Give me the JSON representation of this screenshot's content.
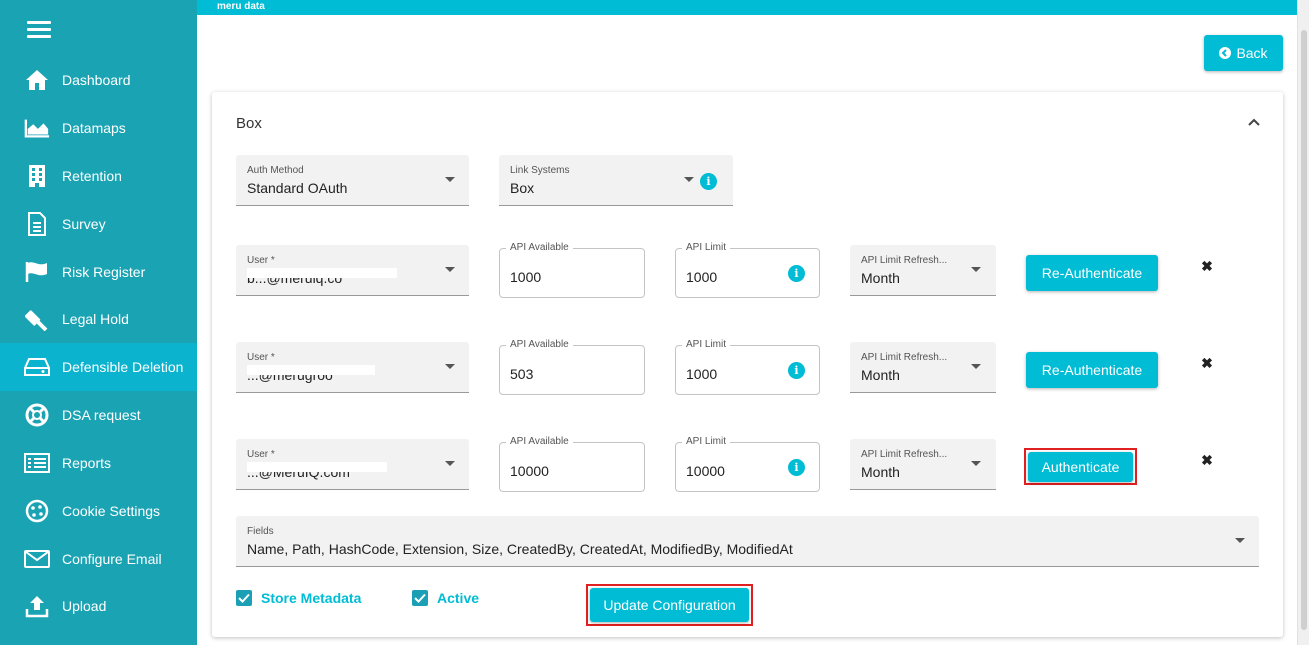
{
  "topbar": {
    "brand": "meru data"
  },
  "sidebar": {
    "items": [
      {
        "label": "Dashboard",
        "icon": "home-icon"
      },
      {
        "label": "Datamaps",
        "icon": "area-chart-icon"
      },
      {
        "label": "Retention",
        "icon": "building-icon"
      },
      {
        "label": "Survey",
        "icon": "document-icon"
      },
      {
        "label": "Risk Register",
        "icon": "flag-icon"
      },
      {
        "label": "Legal Hold",
        "icon": "gavel-icon"
      },
      {
        "label": "Defensible Deletion",
        "icon": "hard-drive-icon",
        "active": true
      },
      {
        "label": "DSA request",
        "icon": "life-ring-icon"
      },
      {
        "label": "Reports",
        "icon": "list-icon"
      },
      {
        "label": "Cookie Settings",
        "icon": "cookie-icon"
      },
      {
        "label": "Configure Email",
        "icon": "envelope-icon"
      },
      {
        "label": "Upload",
        "icon": "upload-icon"
      }
    ]
  },
  "header": {
    "back_label": "Back"
  },
  "card": {
    "title": "Box",
    "auth_method": {
      "label": "Auth Method",
      "value": "Standard OAuth"
    },
    "link_systems": {
      "label": "Link Systems",
      "value": "Box"
    },
    "users": [
      {
        "user_label": "User *",
        "user_value": "b...@meruiq.co",
        "api_available_label": "API Available",
        "api_available": "1000",
        "api_limit_label": "API Limit",
        "api_limit": "1000",
        "refresh_label": "API Limit Refresh...",
        "refresh_value": "Month",
        "action_label": "Re-Authenticate"
      },
      {
        "user_label": "User *",
        "user_value": "...@merugroo",
        "api_available_label": "API Available",
        "api_available": "503",
        "api_limit_label": "API Limit",
        "api_limit": "1000",
        "refresh_label": "API Limit Refresh...",
        "refresh_value": "Month",
        "action_label": "Re-Authenticate"
      },
      {
        "user_label": "User *",
        "user_value": "...@MeruIQ.com",
        "api_available_label": "API Available",
        "api_available": "10000",
        "api_limit_label": "API Limit",
        "api_limit": "10000",
        "refresh_label": "API Limit Refresh...",
        "refresh_value": "Month",
        "action_label": "Authenticate"
      }
    ],
    "fields": {
      "label": "Fields",
      "value": "Name, Path, HashCode, Extension, Size, CreatedBy, CreatedAt, ModifiedBy, ModifiedAt"
    },
    "store_metadata_label": "Store Metadata",
    "active_label": "Active",
    "update_label": "Update Configuration"
  },
  "colors": {
    "sidebar": "#1aa3b3",
    "accent": "#00bcd4",
    "highlight": "#e02020"
  }
}
